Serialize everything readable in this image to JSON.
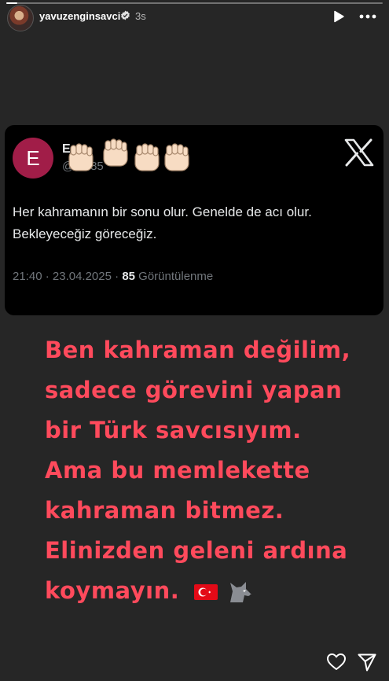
{
  "story": {
    "progress": 0.03
  },
  "header": {
    "username": "yavuzenginsavci",
    "time_ago": "3s",
    "avatar_icon": "profile-avatar",
    "verified_icon": "verified-badge-icon",
    "play_icon": "play-icon",
    "more_icon": "more-horizontal-icon"
  },
  "tweet": {
    "avatar_letter": "E",
    "avatar_color": "#a11d48",
    "display_name": "E",
    "handle": "@ 3085",
    "overlay_emoji": "✊🏻✊🏻✊🏻✊🏻",
    "text": "Her kahramanın bir sonu olur. Genelde de acı olur. Bekleyeceğiz göreceğiz.",
    "time": "21:40",
    "date": "23.04.2025",
    "views_count": "85",
    "views_label": "Görüntülenme",
    "logo_icon": "x-logo-icon"
  },
  "story_text": {
    "lines": [
      "Ben kahraman değilim,",
      "sadece görevini yapan",
      "bir Türk savcısıyım.",
      "Ama bu memlekette",
      "kahraman bitmez.",
      "Elinizden geleni ardına",
      "koymayın."
    ],
    "color": "#ff4a5c",
    "emojis": [
      "turkish-flag-icon",
      "wolf-icon"
    ]
  },
  "footer": {
    "like_icon": "heart-icon",
    "send_icon": "send-icon"
  }
}
